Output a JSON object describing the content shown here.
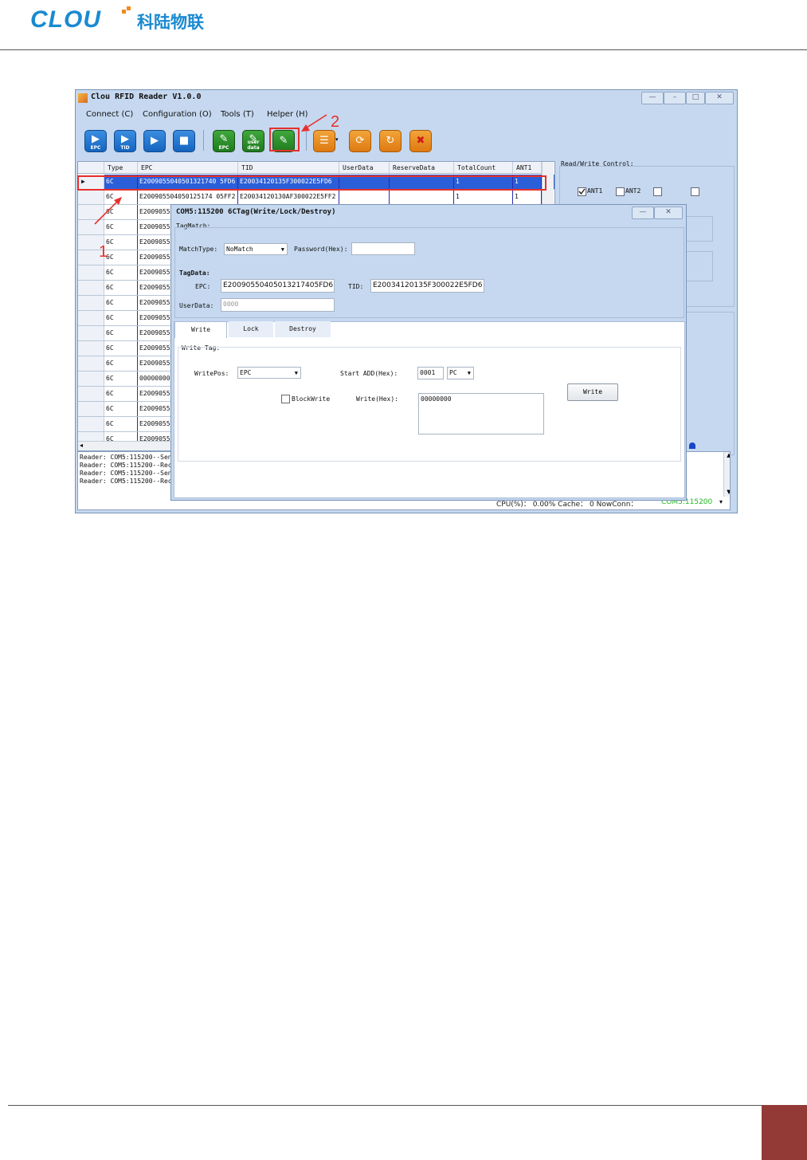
{
  "header": {
    "logo_text": "CLOU",
    "logo_cn": "科陆物联"
  },
  "app": {
    "title": "Clou RFID Reader V1.0.0",
    "menu": [
      "Connect (C)",
      "Configuration (O)",
      "Tools (T)",
      "Helper (H)"
    ],
    "toolbar": {
      "epc_label": "EPC",
      "tid_label": "TID",
      "epc_write_label": "EPC",
      "user_data_label": "user data"
    },
    "grid": {
      "columns": [
        "Type",
        "EPC",
        "TID",
        "UserData",
        "ReserveData",
        "TotalCount",
        "ANT1"
      ],
      "rows": [
        {
          "type": "6C",
          "epc": "E2009055040501321740 5FD6",
          "tid": "E20034120135F300022E5FD6",
          "total": "1",
          "ant1": "1"
        },
        {
          "type": "6C",
          "epc": "E200905504050125174 05FF2",
          "tid": "E20034120130AF300022E5FF2",
          "total": "1",
          "ant1": "1"
        },
        {
          "type": "6C",
          "epc": "E20090550"
        },
        {
          "type": "6C",
          "epc": "E20090550"
        },
        {
          "type": "6C",
          "epc": "E20090550"
        },
        {
          "type": "6C",
          "epc": "E20090550"
        },
        {
          "type": "6C",
          "epc": "E20090550"
        },
        {
          "type": "6C",
          "epc": "E20090550"
        },
        {
          "type": "6C",
          "epc": "E20090550"
        },
        {
          "type": "6C",
          "epc": "E20090550"
        },
        {
          "type": "6C",
          "epc": "E20090550"
        },
        {
          "type": "6C",
          "epc": "E20090550"
        },
        {
          "type": "6C",
          "epc": "E20090550"
        },
        {
          "type": "6C",
          "epc": "00000000"
        },
        {
          "type": "6C",
          "epc": "E20090550"
        },
        {
          "type": "6C",
          "epc": "E20090550"
        },
        {
          "type": "6C",
          "epc": "E20090550"
        },
        {
          "type": "6C",
          "epc": "E20090550"
        }
      ]
    },
    "rw": {
      "title": "Read/Write Control:",
      "ant1": "ANT1",
      "ant2": "ANT2"
    },
    "log": [
      "Reader: COM5:115200--Sen",
      "Reader: COM5:115200--Rec",
      "Reader: COM5:115200--Sen",
      "Reader: COM5:115200--Rec"
    ],
    "status": "CPU(%)：  0.00%  Cache：  0  NowConn：",
    "status_conn": "COM5:115200"
  },
  "dialog": {
    "title": "COM5:115200 6CTag(Write/Lock/Destroy)",
    "tagmatch_label": "TagMatch:",
    "matchtype_label": "MatchType:",
    "matchtype_value": "NoMatch",
    "password_label": "Password(Hex):",
    "password_value": "",
    "tagdata_label": "TagData:",
    "epc_label": "EPC:",
    "epc_value": "E20090550405013217405FD6",
    "tid_label": "TID:",
    "tid_value": "E20034120135F300022E5FD6",
    "userdata_label": "UserData:",
    "userdata_value": "0000",
    "tabs": [
      "Write",
      "Lock",
      "Destroy"
    ],
    "writetag_label": "Write Tag:",
    "writepos_label": "WritePos:",
    "writepos_value": "EPC",
    "startadd_label": "Start ADD(Hex):",
    "startadd_value": "0001",
    "startadd_unit": "PC",
    "blockwrite_label": "BlockWrite",
    "writehex_label": "Write(Hex):",
    "writehex_value": "00000000",
    "write_button": "Write"
  },
  "annotations": {
    "one": "1",
    "two": "2"
  }
}
